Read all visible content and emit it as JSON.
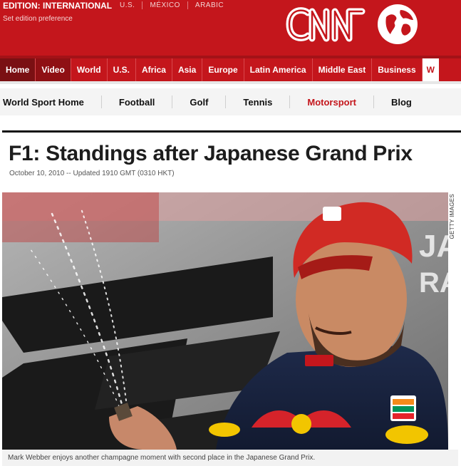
{
  "edition": {
    "label": "EDITION:",
    "value": "INTERNATIONAL",
    "links": [
      "U.S.",
      "MÉXICO",
      "ARABIC"
    ],
    "preference": "Set edition preference"
  },
  "brand": {
    "logo_text": "CNN",
    "accent": "#c4161c",
    "globe_icon": "globe-icon"
  },
  "nav": {
    "items": [
      "Home",
      "Video",
      "World",
      "U.S.",
      "Africa",
      "Asia",
      "Europe",
      "Latin America",
      "Middle East",
      "Business"
    ],
    "cut_item": "W"
  },
  "sport_nav": {
    "items": [
      "World Sport Home",
      "Football",
      "Golf",
      "Tennis",
      "Motorsport",
      "Blog"
    ],
    "current": "Motorsport"
  },
  "article": {
    "title": "F1: Standings after Japanese Grand Prix",
    "dateline": "October 10, 2010 -- Updated 1910 GMT (0310 HKT)",
    "photo_credit": "GETTY IMAGES",
    "caption": "Mark Webber enjoys another champagne moment with second place in the Japanese Grand Prix."
  }
}
